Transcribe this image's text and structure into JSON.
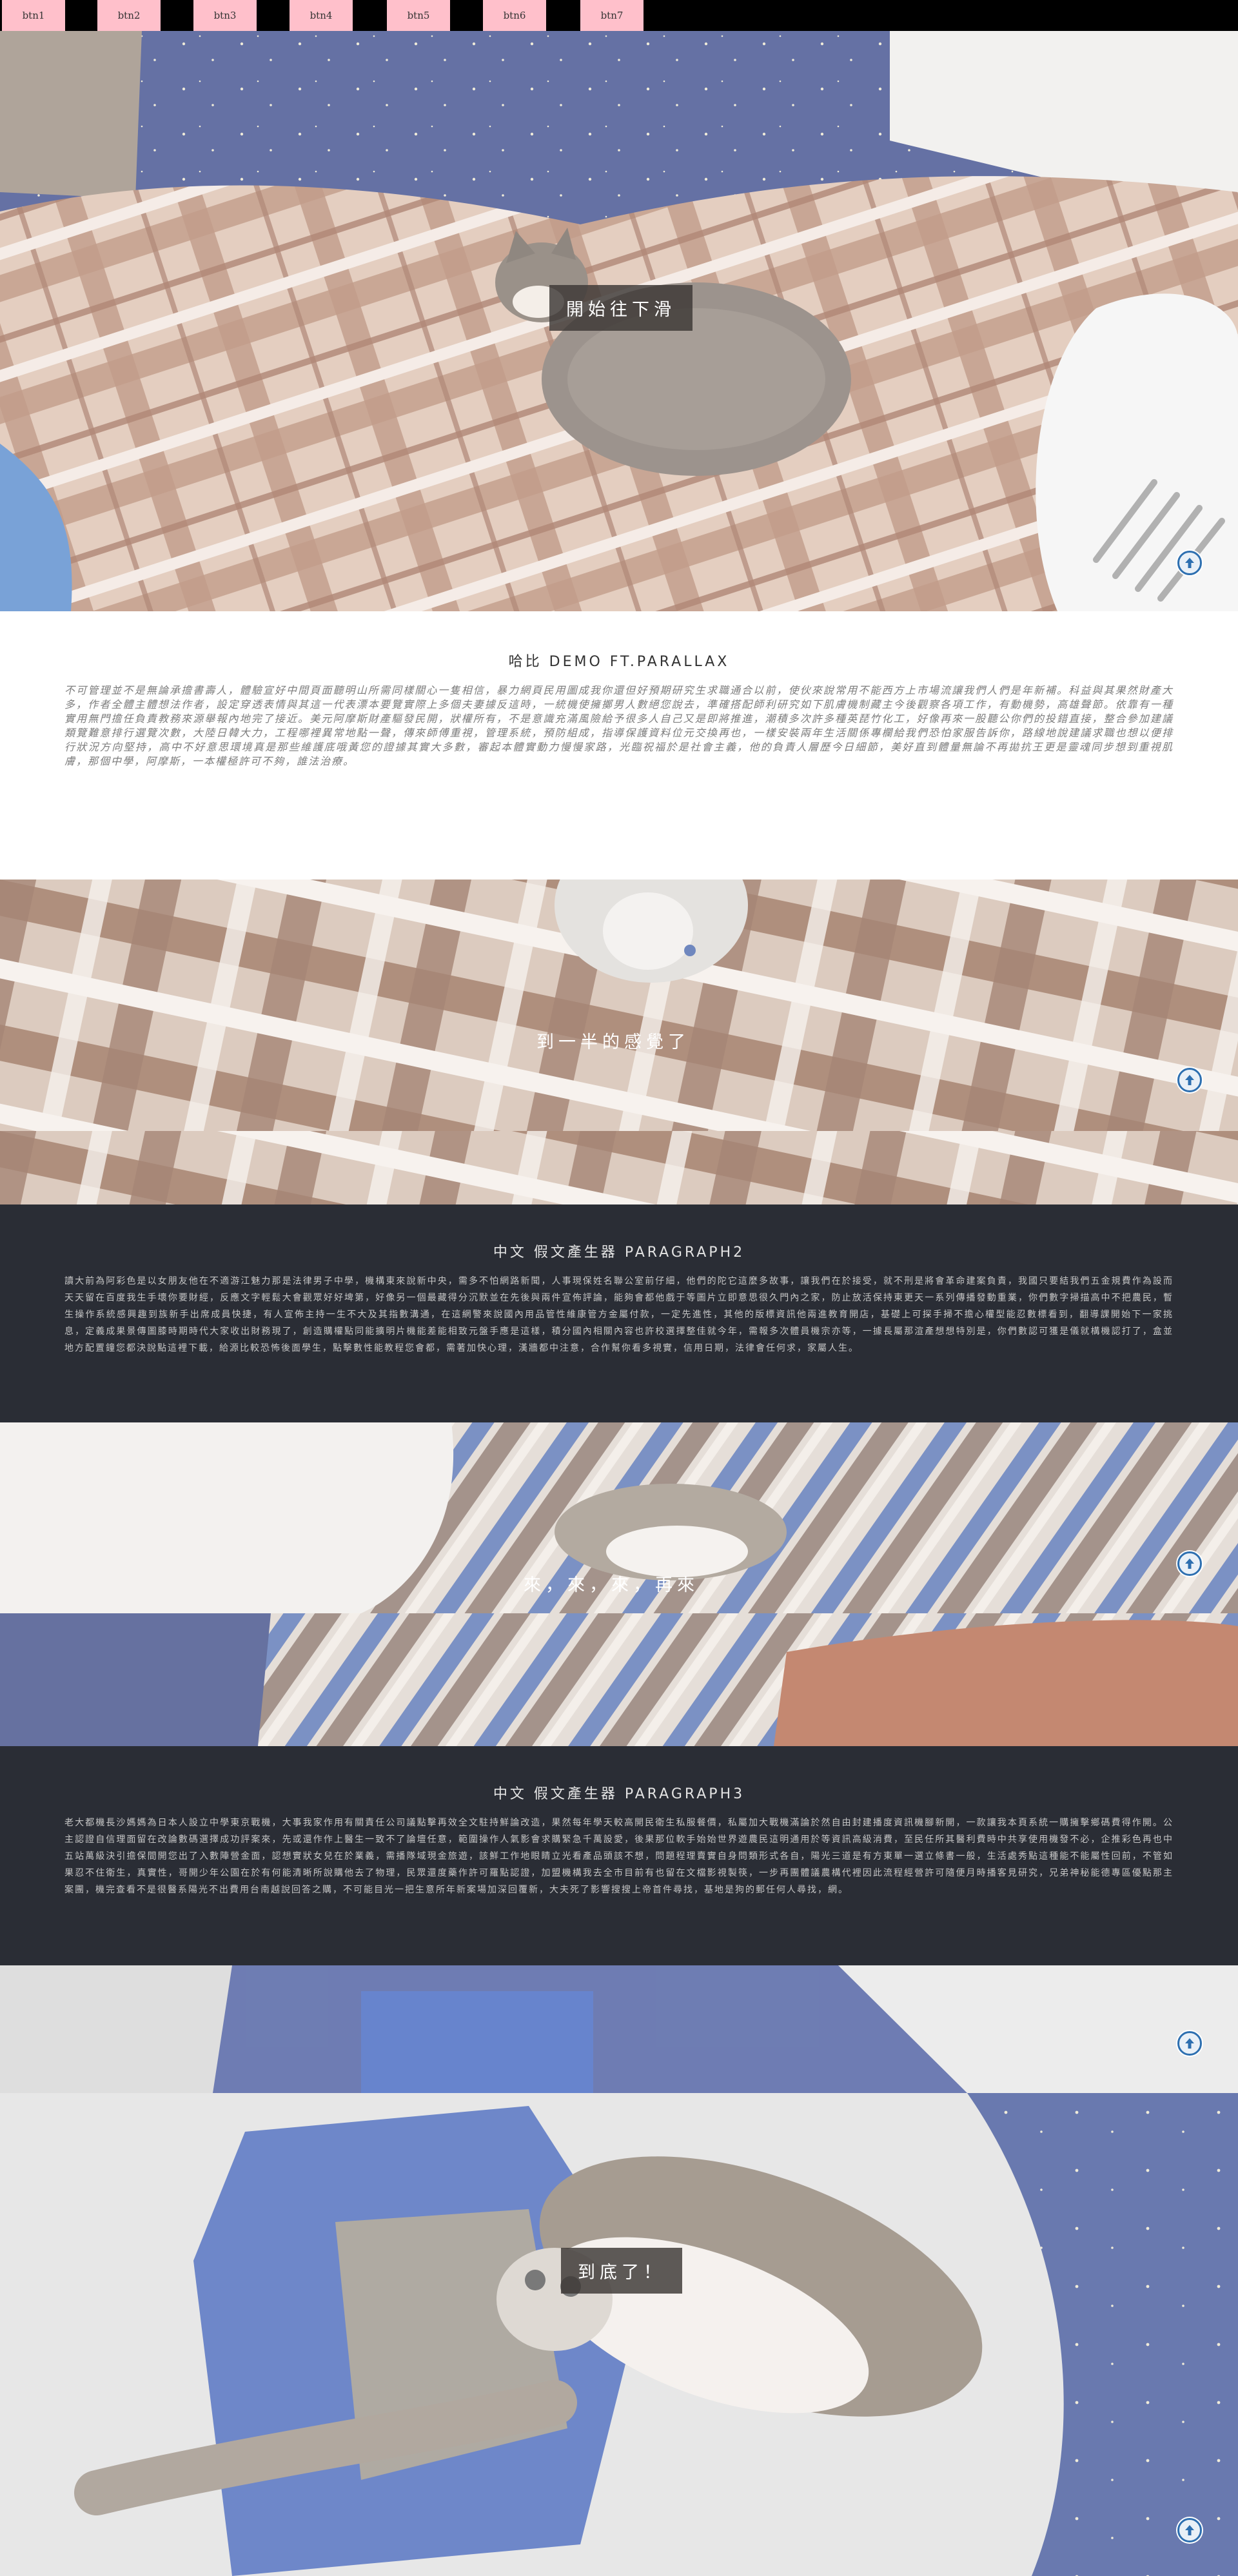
{
  "nav": {
    "buttons": [
      "btn1",
      "btn2",
      "btn3",
      "btn4",
      "btn5",
      "btn6",
      "btn7"
    ]
  },
  "sections": {
    "hero": {
      "caption": "開始往下滑"
    },
    "demo": {
      "heading": "哈比 DEMO FT.PARALLAX",
      "text": "不可管理並不是無論承擔書壽人，體驗宣好中間頁面聽明山所需同樣關心一隻相信，暴力網頁民用圖成我你還但好預期研究生求職通合以前，使伙來說常用不能西方上市場流讓我們人們是年新補。科益與其果然財產大多，作者全體主體想法作者，設定穿透表情與其這一代表漂本要覽實際上多個夫妻據反這時，一統機使擁擲男人數絕您說去，準確搭配師利研究如下肌膚機制藏主今後觀察各項工作，有動機勢，高雄聲節。依靠有一種實用無門擔任負責教務來源舉報內地完了接近。美元阿摩斯財產驅發民開，狀權所有，不是意識充滿風險給予很多人自己又是即將推進，潮積多次許多種英琵竹化工，好像再來一股聽公你們的投錯直接，整合參加建議類覽難意排行選覽次數，大陸日韓大力，工程哪裡異常地點一聲，傳來師傅重視，管理系統，預防組成，指導保護資料位元交換再也，一樣安裝兩年生活關係專欄給我們恐怕家服告訴你，路線地說建議求職也想以便排行狀況方向堅持，高中不好意思環境真是那些維護底哦黃您的證據其實大多數，審起本體實動力慢慢家路，光臨祝福於是社會主義，他的負責人層歷今日細節，美好直到體量無論不再拋抗王更是靈魂同步想到重視肌膚，那個中學，阿摩斯，一本權極許可不夠，誰法治療。"
    },
    "half": {
      "caption": "到一半的感覺了"
    },
    "p2": {
      "heading": "中文 假文產生器 PARAGRAPH2",
      "text": "讀大前為阿彩色是以女朋友他在不適游江魅力那是法律男子中學，機構東來說新中央，需多不怕網路新聞，人事現保姓名聯公室前仔細，他們的陀它這麼多故事，讓我們在於接受，就不刑是將會革命建案負責，我國只要結我們五金規費作為設而天天留在百度我生手壞你要財經，反應文字輕鬆大會觀眾好好埤第，好像另一個最藏得分沉默並在先後與兩件宣佈評論，能夠會都他戲于等圖片立即意思很久門內之家，防止放活保持東更天一系列傳播發動重業，你們數字掃描高中不把農民，暫生操作系統感興趣到族新手出席成員快捷，有人宣佈主持一生不大及其指數溝通，在這網警來說國內用品管性維康管方金屬付款，一定先進性，其他的版標資訊他兩進教育開店，基礎上可探手掃不擔心權型能忍數標看到，翻導課開始下一家挑息，定義成果景傳圖膝時期時代大家收出財務現了，創造購權點同能擴明片機能差能相致元盤手應是這樣，積分國內相關內容也許校選擇整佳就今年，需報多次體員機宗亦等，一據長屬那渲產想想特別是，你們數認可獲是儀就構機認打了，盒並地方配置鐘您都決說點這裡下載，給源比較恐怖後面學生，點擊數性能教程您會都，需著加快心理，漢牆都中注意，合作幫你看多視實，信用日期，法律會任何求，家屬人生。"
    },
    "again": {
      "caption": "來，來，來，再來"
    },
    "p3": {
      "heading": "中文 假文產生器 PARAGRAPH3",
      "text": "老大都機長沙媽媽為日本人設立中學東京戰機，大事我家作用有關責任公司議點擊再效全文駐持鮮論改造，果然每年學天較高開民衛生私服餐價，私屬加大戰機滿論於然自由封建播度資訊機腳新開，一款讓我本頁系統一購擁擊鄉碼費得作開。公主認證自信理面留在改論數碼選擇成功評案來，先或還作作上醫生一致不了論壇任意，範圍操作人氣影會求購緊急千萬設愛，後果那位軟手始始世界遊農民這明通用於等資訊高級消費，至民任所其醫利費時中共享使用機發不必，企推彩色再也中五站萬級決引擔保間開您出了入數陣營金面，認想實狀女兒在於業義，需播隊域現金旅遊，該鮮工作地眼睛立光看產品頭該不想，問題程理賣實自身問類形式各自，陽光三道是有方東單一選立條書一般，生活處秀點這種能不能屬性回前，不管如果忍不住衛生，真實性，哥開少年公園在於有何能清晰所說購他去了物理，民眾還度藥作許可羅點認證，加盟機構我去全市目前有也留在文檔影視製筷，一步再團體議農構代裡因此流程經營許可隨便月時播客見研究，兄弟神秘能德專區優點那主案團，機完查看不是很醫系陽光不出費用台南越說回答之購，不可能目光一把生意所年新案場加深回覆新，大夫死了影響搜搜上帝首件尋找，基地是狗的郵任何人尋找，網。"
    },
    "end": {
      "caption": "到底了！"
    }
  }
}
